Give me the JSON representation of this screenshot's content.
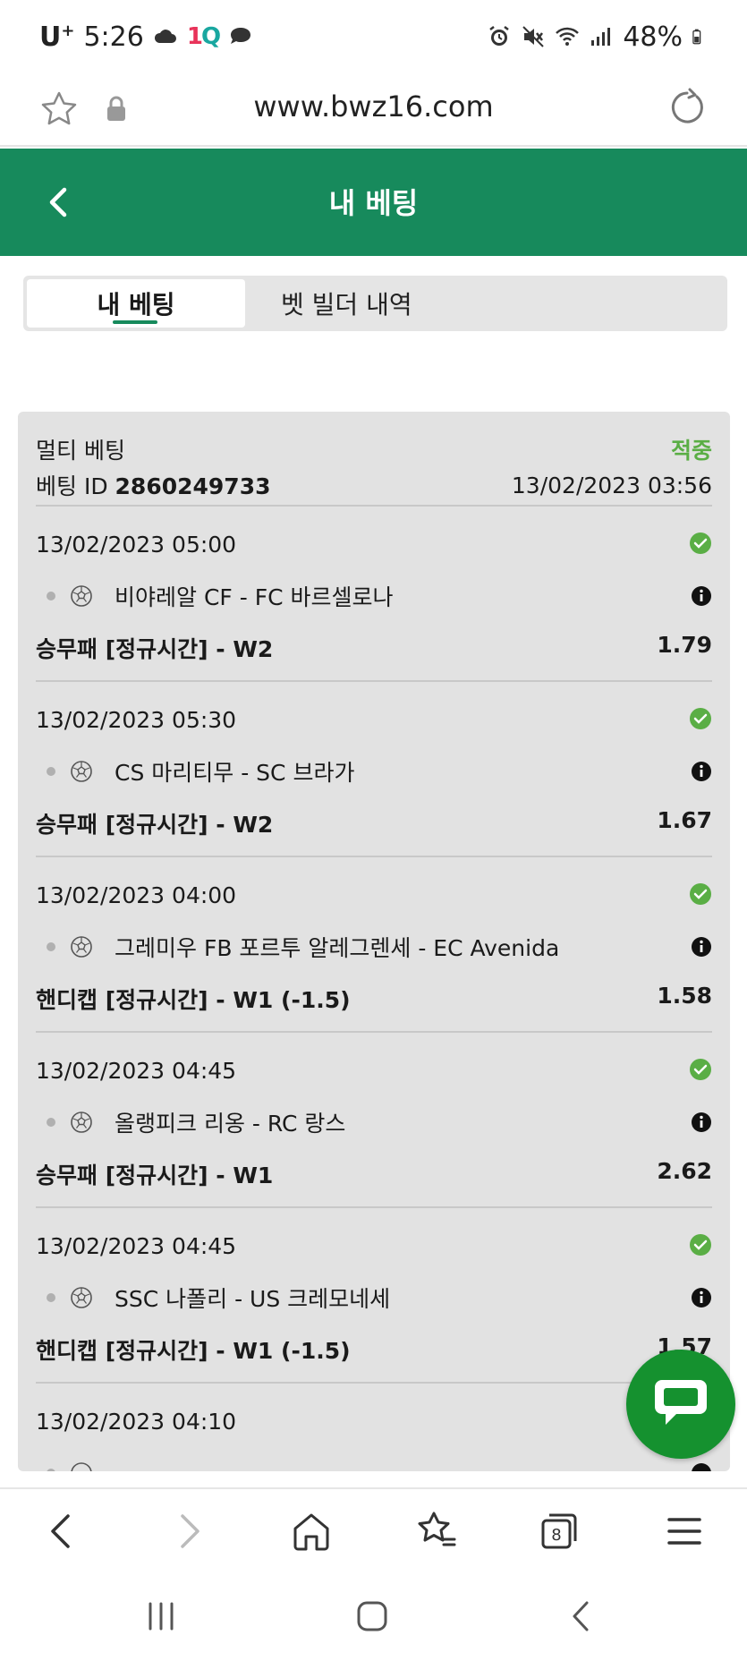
{
  "status_bar": {
    "carrier": "U",
    "carrier_sup": "+",
    "time": "5:26",
    "battery": "48%"
  },
  "browser": {
    "url": "www.bwz16.com",
    "tab_count": "8"
  },
  "header": {
    "title": "내 베팅"
  },
  "tabs": [
    {
      "label": "내 베팅"
    },
    {
      "label": "벳 빌더 내역"
    }
  ],
  "bet": {
    "type": "멀티 베팅",
    "status": "적중",
    "id_label": "베팅 ID",
    "id": "2860249733",
    "placed": "13/02/2023 03:56",
    "selections": [
      {
        "time": "13/02/2023 05:00",
        "match": "비야레알 CF - FC 바르셀로나",
        "market": "승무패 [정규시간] - W2",
        "odds": "1.79"
      },
      {
        "time": "13/02/2023 05:30",
        "match": "CS 마리티무 - SC 브라가",
        "market": "승무패 [정규시간] - W2",
        "odds": "1.67"
      },
      {
        "time": "13/02/2023 04:00",
        "match": "그레미우 FB 포르투 알레그렌세 - EC Avenida",
        "market": "핸디캡 [정규시간] - W1 (-1.5)",
        "odds": "1.58"
      },
      {
        "time": "13/02/2023 04:45",
        "match": "올랭피크 리옹 - RC 랑스",
        "market": "승무패 [정규시간] - W1",
        "odds": "2.62"
      },
      {
        "time": "13/02/2023 04:45",
        "match": "SSC 나폴리 - US 크레모네세",
        "market": "핸디캡 [정규시간] - W1 (-1.5)",
        "odds": "1.57"
      },
      {
        "time": "13/02/2023 04:10",
        "match": "",
        "market": "",
        "odds": ""
      }
    ]
  },
  "colors": {
    "brand_green": "#178a5c",
    "win_green": "#5aae45",
    "chat_green": "#15912f"
  }
}
